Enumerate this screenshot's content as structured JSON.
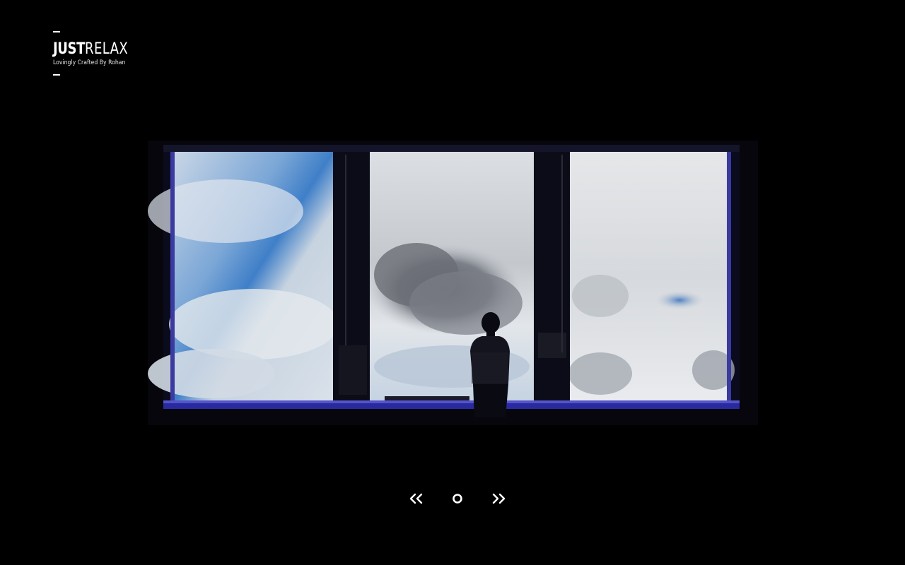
{
  "logo": {
    "title_bold": "JUST",
    "title_light": "RELAX",
    "tagline": "Lovingly Crafted By Rohan"
  },
  "slideshow": {
    "image_icon": "slide-image",
    "controls": {
      "prev_icon": "double-chevron-left-icon",
      "play_icon": "circle-icon",
      "next_icon": "double-chevron-right-icon"
    }
  },
  "colors": {
    "background": "#000000",
    "foreground": "#ffffff"
  }
}
